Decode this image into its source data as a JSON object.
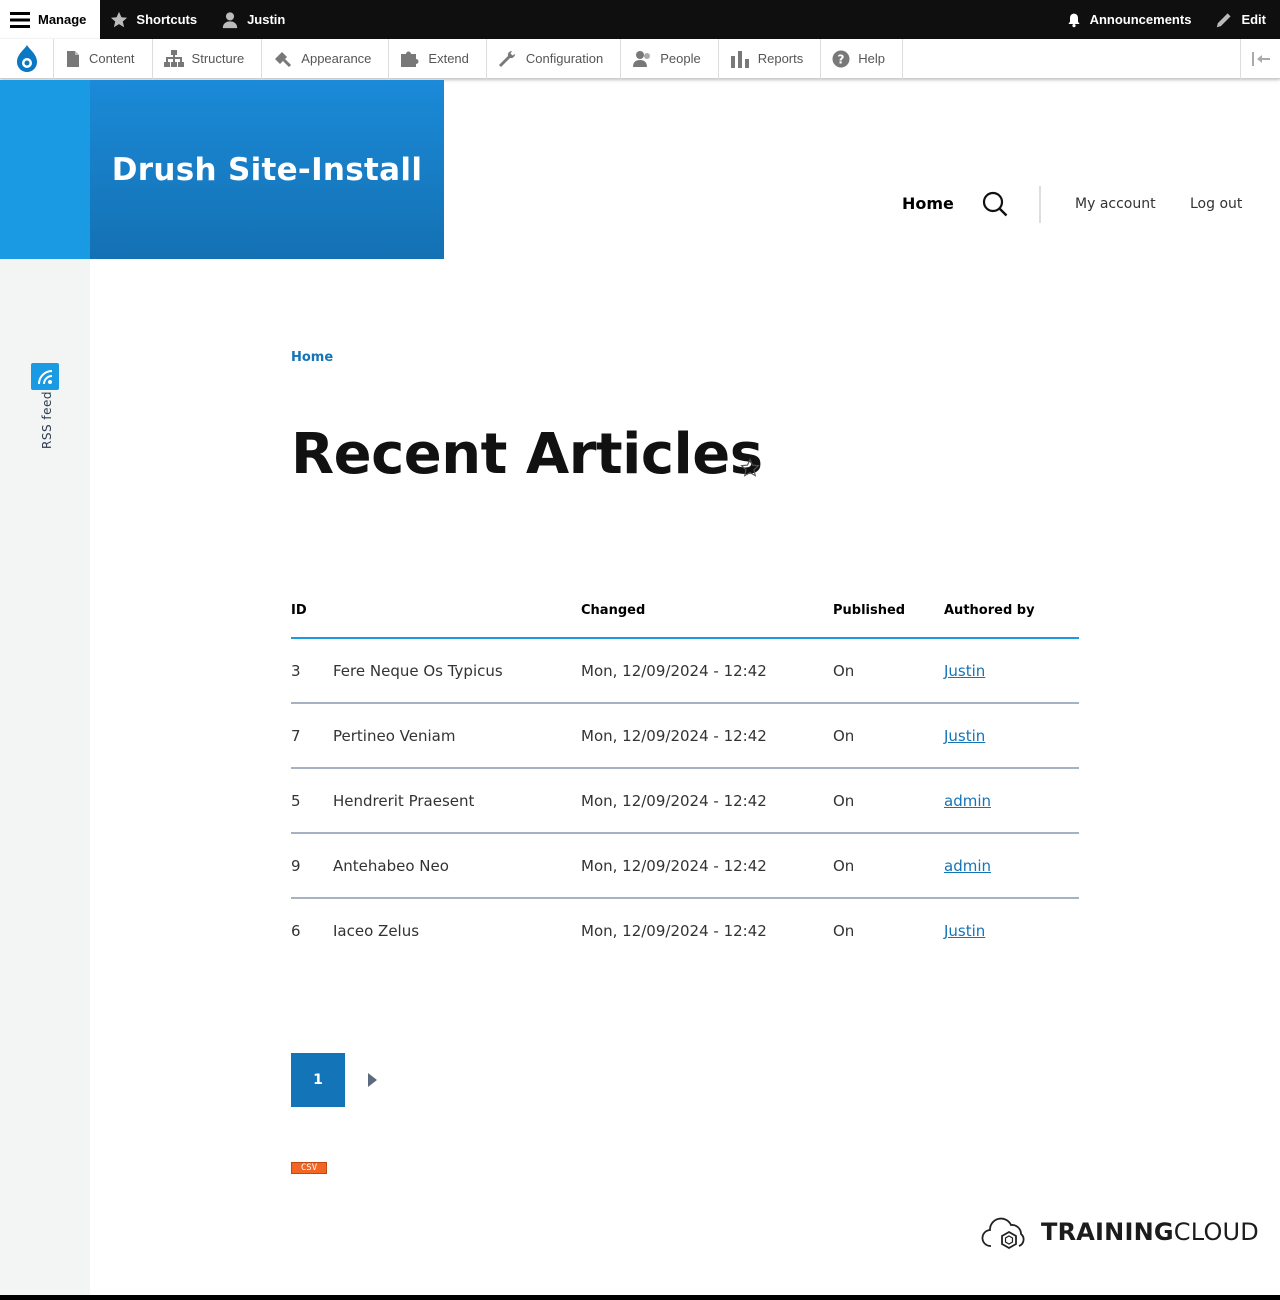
{
  "toolbar": {
    "manage": "Manage",
    "shortcuts": "Shortcuts",
    "user": "Justin",
    "announcements": "Announcements",
    "edit": "Edit"
  },
  "admin_menu": {
    "items": [
      "Content",
      "Structure",
      "Appearance",
      "Extend",
      "Configuration",
      "People",
      "Reports",
      "Help"
    ]
  },
  "site": {
    "name": "Drush Site-Install",
    "nav_home": "Home",
    "my_account": "My account",
    "log_out": "Log out"
  },
  "rss": {
    "label": "RSS feed"
  },
  "breadcrumb": {
    "home": "Home"
  },
  "page": {
    "title": "Recent Articles"
  },
  "table": {
    "headers": {
      "id": "ID",
      "changed": "Changed",
      "published": "Published",
      "authored_by": "Authored by"
    },
    "rows": [
      {
        "id": "3",
        "title": "Fere Neque Os Typicus",
        "changed": "Mon, 12/09/2024 - 12:42",
        "published": "On",
        "author": "Justin"
      },
      {
        "id": "7",
        "title": "Pertineo Veniam",
        "changed": "Mon, 12/09/2024 - 12:42",
        "published": "On",
        "author": "Justin"
      },
      {
        "id": "5",
        "title": "Hendrerit Praesent",
        "changed": "Mon, 12/09/2024 - 12:42",
        "published": "On",
        "author": "admin"
      },
      {
        "id": "9",
        "title": "Antehabeo Neo",
        "changed": "Mon, 12/09/2024 - 12:42",
        "published": "On",
        "author": "admin"
      },
      {
        "id": "6",
        "title": "Iaceo Zelus",
        "changed": "Mon, 12/09/2024 - 12:42",
        "published": "On",
        "author": "Justin"
      }
    ]
  },
  "pager": {
    "current": "1"
  },
  "feed": {
    "csv": "CSV"
  },
  "logo": {
    "bold": "TRAINING",
    "regular": "CLOUD"
  },
  "colors": {
    "accent": "#1474b8",
    "brand_blue": "#1b9ae4",
    "csv": "#f26522"
  }
}
